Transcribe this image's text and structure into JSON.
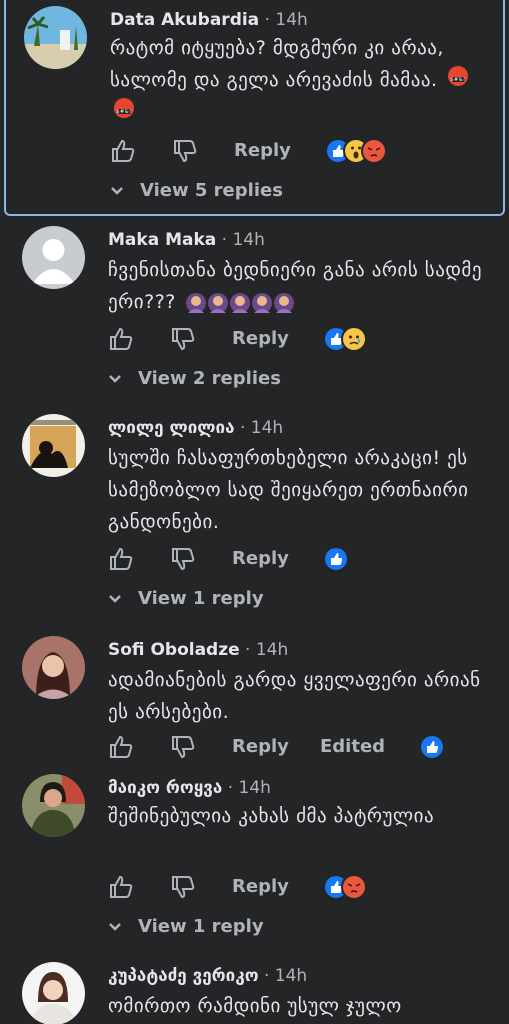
{
  "comments": [
    {
      "name": "Data Akubardia",
      "time": "14h",
      "text": "რატომ იტყუება? მდგმური კი არაა, სალომე და გელა არევაძის მამაა.",
      "actions": {
        "reply": "Reply",
        "reactions": [
          "like-reaction",
          "wow-reaction",
          "angry-reaction"
        ]
      },
      "view_replies": "View 5 replies"
    },
    {
      "name": "Maka Maka",
      "time": "14h",
      "text": "ჩვენისთანა ბედნიერი განა არის სადმე ერი???",
      "actions": {
        "reply": "Reply",
        "reactions": [
          "like-reaction",
          "sad-reaction"
        ]
      },
      "view_replies": "View 2 replies"
    },
    {
      "name": "ლილე ლილია",
      "time": "14h",
      "text": "სულში ჩასაფურთხებელი არაკაცი! ეს სამეზობლო სად შეიყარეთ ერთნაირი განდონები.",
      "actions": {
        "reply": "Reply",
        "reactions": [
          "like-reaction"
        ]
      },
      "view_replies": "View 1 reply"
    },
    {
      "name": "Sofi Oboladze",
      "time": "14h",
      "text": "ადამიანების გარდა ყველაფერი არიან ეს არსებები.",
      "actions": {
        "reply": "Reply",
        "edited": "Edited",
        "reactions": [
          "like-reaction"
        ]
      }
    },
    {
      "name": "მაიკო როყვა",
      "time": "14h",
      "text": "შეშინებულია კახას ძმა პატრულია",
      "actions": {
        "reply": "Reply",
        "reactions": [
          "like-reaction",
          "angry-reaction"
        ]
      },
      "view_replies": "View 1 reply"
    },
    {
      "name": "კუპატაძე ვერიკო",
      "time": "14h",
      "text": "ომირთო რამდინი უსულ ჯულო"
    }
  ],
  "colors": {
    "background": "#242526",
    "text": "#e4e6eb",
    "secondary": "#b0b3b8",
    "like_blue": "#1877f2",
    "highlight_border": "#8fb5e6"
  }
}
